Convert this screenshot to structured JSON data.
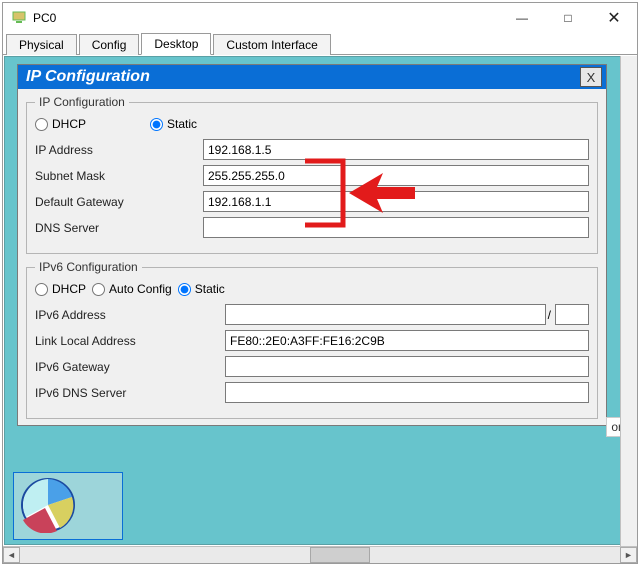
{
  "window": {
    "title": "PC0",
    "min": "—",
    "max": "□",
    "close": "✕"
  },
  "tabs": {
    "physical": "Physical",
    "config": "Config",
    "desktop": "Desktop",
    "custom": "Custom Interface"
  },
  "app": {
    "title": "IP Configuration",
    "close": "X"
  },
  "ipv4": {
    "legend": "IP Configuration",
    "dhcp_label": "DHCP",
    "static_label": "Static",
    "mode": "static",
    "ip_label": "IP Address",
    "ip": "192.168.1.5",
    "mask_label": "Subnet Mask",
    "mask": "255.255.255.0",
    "gw_label": "Default Gateway",
    "gw": "192.168.1.1",
    "dns_label": "DNS Server",
    "dns": ""
  },
  "ipv6": {
    "legend": "IPv6 Configuration",
    "dhcp_label": "DHCP",
    "auto_label": "Auto Config",
    "static_label": "Static",
    "mode": "static",
    "addr_label": "IPv6 Address",
    "addr": "",
    "prefix": "",
    "slash": "/",
    "lla_label": "Link Local Address",
    "lla": "FE80::2E0:A3FF:FE16:2C9B",
    "gw_label": "IPv6 Gateway",
    "gw": "",
    "dns_label": "IPv6 DNS Server",
    "dns": ""
  },
  "obscured_text": "or",
  "icons": {
    "app": "pc",
    "pie": "pie-chart"
  },
  "colors": {
    "titlebar_blue": "#0a6ed6",
    "client_teal": "#67c4cc",
    "annotation_red": "#e21b1b"
  }
}
